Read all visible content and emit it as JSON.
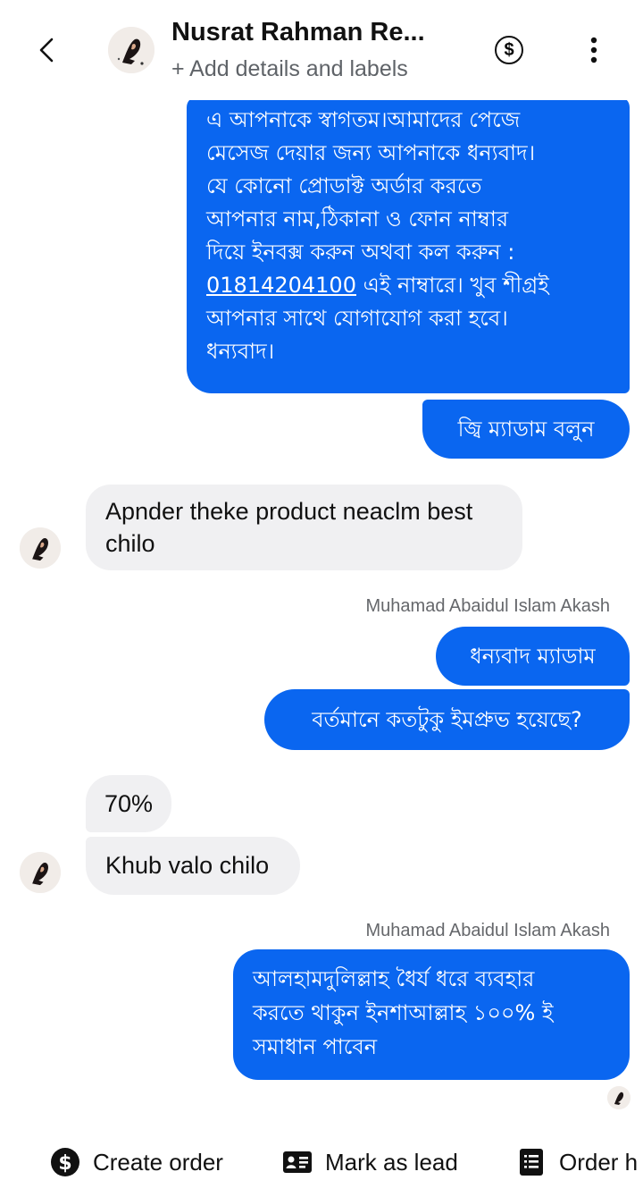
{
  "header": {
    "title": "Nusrat Rahman Re...",
    "subtitle": "+ Add details and labels"
  },
  "messages": {
    "m1_lines": [
      "এ আপনাকে স্বাগতম।আমাদের পেজে",
      "মেসেজ দেয়ার জন্য আপনাকে ধন্যবাদ।",
      "যে কোনো প্রোডাক্ট  অর্ডার করতে",
      "আপনার নাম,ঠিকানা ও ফোন নাম্বার",
      "দিয়ে ইনবক্স করুন  অথবা কল করুন :",
      "এই নাম্বারে।  খুব শীগ্রই",
      "আপনার সাথে যোগাযোগ করা হবে।",
      "ধন্যবাদ।"
    ],
    "m1_phone": "01814204100",
    "m2": "জ্বি ম্যাডাম বলুন",
    "m3_lines": [
      "Apnder theke product neaclm best",
      "chilo"
    ],
    "sender_1": "Muhamad Abaidul Islam Akash",
    "m4": "ধন্যবাদ ম্যাডাম",
    "m5": "বর্তমানে কতটুকু ইমপ্রুভ হয়েছে?",
    "m6": "70%",
    "m7": "Khub valo chilo",
    "sender_2": "Muhamad Abaidul Islam Akash",
    "m8_lines": [
      "আলহামদুলিল্লাহ ধৈর্য ধরে ব্যবহার",
      "করতে থাকুন ইনশাআল্লাহ ১০০% ই",
      "সমাধান পাবেন"
    ]
  },
  "actions": {
    "create_order": "Create order",
    "mark_as_lead": "Mark as lead",
    "order_history": "Order h"
  },
  "colors": {
    "outgoing_bubble": "#0a66f0",
    "incoming_bubble": "#f0f0f2",
    "sender_text": "#65676b"
  },
  "icons": {
    "back": "chevron-left-icon",
    "payments": "dollar-circle-icon",
    "more": "vertical-dots-icon",
    "create_order": "dollar-circle-filled-icon",
    "mark_as_lead": "id-card-icon",
    "order_history": "receipt-icon"
  }
}
